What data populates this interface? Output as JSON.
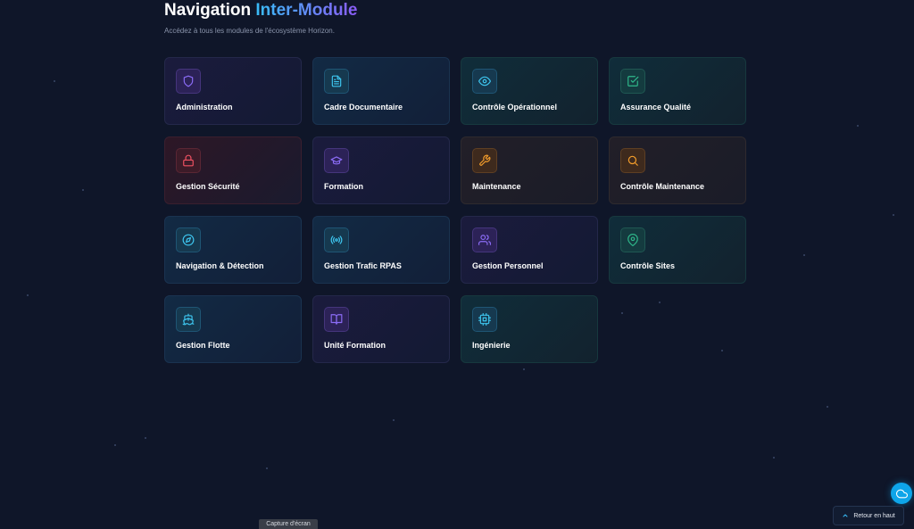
{
  "header": {
    "title_main": "Navigation ",
    "title_accent": "Inter-Module",
    "subtitle": "Accédez à tous les modules de l'écosystème Horizon."
  },
  "modules": [
    {
      "label": "Administration",
      "icon": "shield-icon",
      "color": "#8b6cf6"
    },
    {
      "label": "Cadre Documentaire",
      "icon": "file-text-icon",
      "color": "#3ec6ef"
    },
    {
      "label": "Contrôle Opérationnel",
      "icon": "eye-icon",
      "color": "#3ec6ef"
    },
    {
      "label": "Assurance Qualité",
      "icon": "check-square-icon",
      "color": "#2fb98b"
    },
    {
      "label": "Gestion Sécurité",
      "icon": "lock-icon",
      "color": "#f05262"
    },
    {
      "label": "Formation",
      "icon": "graduation-cap-icon",
      "color": "#8b6cf6"
    },
    {
      "label": "Maintenance",
      "icon": "wrench-icon",
      "color": "#f59e2b"
    },
    {
      "label": "Contrôle Maintenance",
      "icon": "search-icon",
      "color": "#f59e2b"
    },
    {
      "label": "Navigation & Détection",
      "icon": "compass-icon",
      "color": "#3ec6ef"
    },
    {
      "label": "Gestion Trafic RPAS",
      "icon": "radio-icon",
      "color": "#3ec6ef"
    },
    {
      "label": "Gestion Personnel",
      "icon": "users-icon",
      "color": "#8b6cf6"
    },
    {
      "label": "Contrôle Sites",
      "icon": "map-pin-icon",
      "color": "#2fb98b"
    },
    {
      "label": "Gestion Flotte",
      "icon": "ship-icon",
      "color": "#3ec6ef"
    },
    {
      "label": "Unité Formation",
      "icon": "book-open-icon",
      "color": "#8b6cf6"
    },
    {
      "label": "Ingénierie",
      "icon": "cpu-icon",
      "color": "#3ec6ef"
    }
  ],
  "overlay": {
    "capture_label": "Capture d'écran",
    "back_to_top": "Retour en haut",
    "cloud_icon": "cloud-icon"
  },
  "colors": {
    "background": "#0f1629",
    "accent_start": "#38bdf8",
    "accent_end": "#8b5cf6",
    "floating_button": "#0ea5e9"
  }
}
